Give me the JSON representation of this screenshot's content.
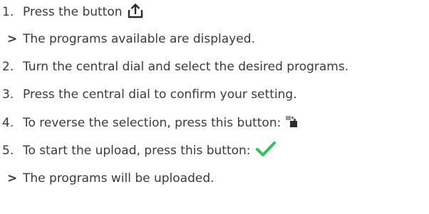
{
  "steps": [
    {
      "marker": "1.",
      "text": "Press the button",
      "icon": "upload-icon"
    },
    {
      "marker": ">",
      "text": "The programs available are displayed."
    },
    {
      "marker": "2.",
      "text": "Turn the central dial and select the desired programs."
    },
    {
      "marker": "3.",
      "text": "Press the central dial to confirm your setting."
    },
    {
      "marker": "4.",
      "text": "To reverse the selection, press this button:",
      "icon": "reverse-selection-icon"
    },
    {
      "marker": "5.",
      "text": "To start the upload, press this button:",
      "icon": "checkmark-icon"
    },
    {
      "marker": ">",
      "text": "The programs will be uploaded."
    }
  ],
  "colors": {
    "text": "#3a3a3a",
    "check": "#2ec25a",
    "icon_dark": "#2b2b2b"
  }
}
